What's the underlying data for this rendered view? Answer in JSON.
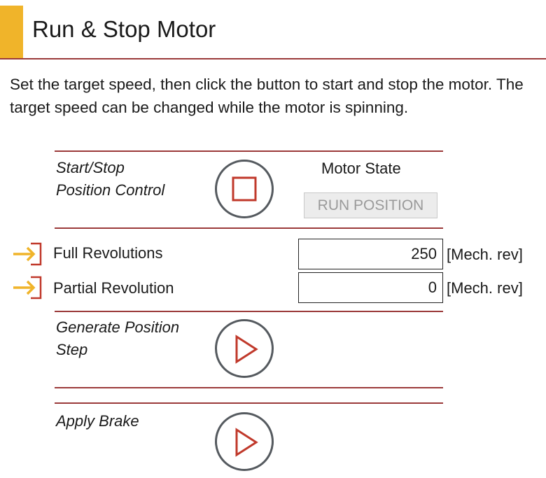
{
  "header": {
    "title": "Run & Stop Motor",
    "accent_color": "#f0b42a",
    "rule_color": "#9b3a3a"
  },
  "description": "Set the target speed, then click the button to start and stop the motor. The target speed can be changed while the motor is spinning.",
  "start_stop": {
    "label_line1": "Start/Stop",
    "label_line2": "Position Control",
    "button_icon": "stop-square-icon",
    "motor_state_label": "Motor State",
    "motor_state_value": "RUN POSITION"
  },
  "params": [
    {
      "icon": "input-arrow-icon",
      "label": "Full Revolutions",
      "value": "250",
      "unit": "[Mech. rev]"
    },
    {
      "icon": "input-arrow-icon",
      "label": "Partial Revolution",
      "value": "0",
      "unit": "[Mech. rev]"
    }
  ],
  "generate_step": {
    "label_line1": "Generate Position",
    "label_line2": "Step",
    "button_icon": "play-triangle-icon"
  },
  "apply_brake": {
    "label": "Apply Brake",
    "button_icon": "play-triangle-icon"
  },
  "colors": {
    "icon_red": "#c0392b",
    "arrow_orange": "#f0b42a",
    "button_border": "#555a5f"
  }
}
